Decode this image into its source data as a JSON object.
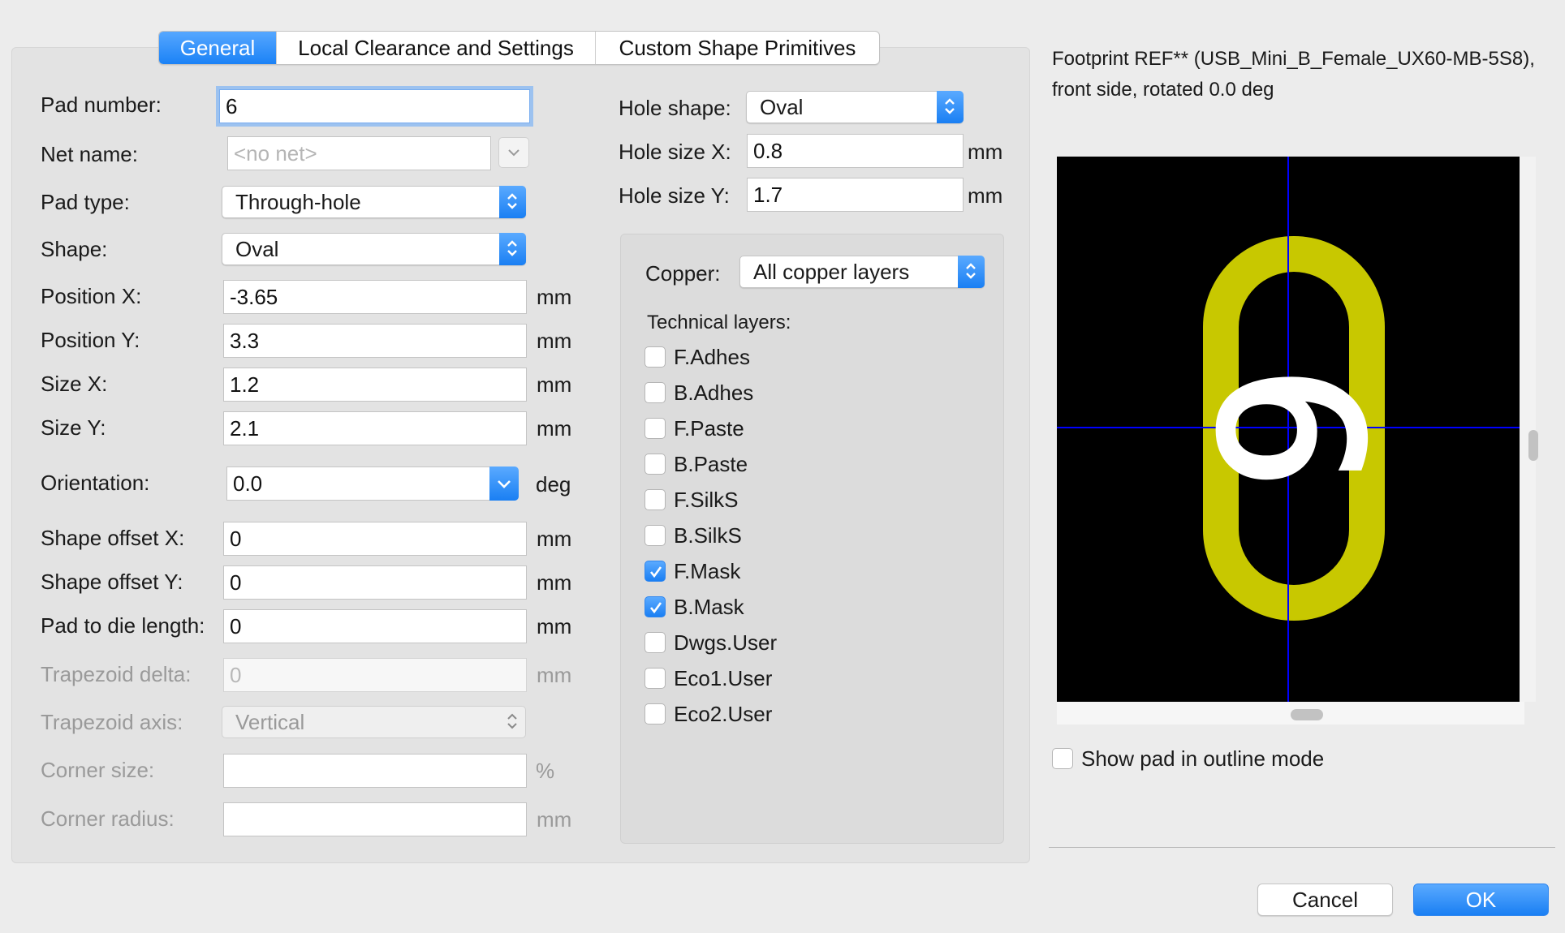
{
  "tabs": [
    "General",
    "Local Clearance and Settings",
    "Custom Shape Primitives"
  ],
  "form": {
    "pad_number": {
      "label": "Pad number:",
      "value": "6"
    },
    "net_name": {
      "label": "Net name:",
      "placeholder": "<no net>"
    },
    "pad_type": {
      "label": "Pad type:",
      "value": "Through-hole"
    },
    "shape": {
      "label": "Shape:",
      "value": "Oval"
    },
    "position_x": {
      "label": "Position X:",
      "value": "-3.65",
      "unit": "mm"
    },
    "position_y": {
      "label": "Position Y:",
      "value": "3.3",
      "unit": "mm"
    },
    "size_x": {
      "label": "Size X:",
      "value": "1.2",
      "unit": "mm"
    },
    "size_y": {
      "label": "Size Y:",
      "value": "2.1",
      "unit": "mm"
    },
    "orientation": {
      "label": "Orientation:",
      "value": "0.0",
      "unit": "deg"
    },
    "shape_offset_x": {
      "label": "Shape offset X:",
      "value": "0",
      "unit": "mm"
    },
    "shape_offset_y": {
      "label": "Shape offset Y:",
      "value": "0",
      "unit": "mm"
    },
    "pad_to_die": {
      "label": "Pad to die length:",
      "value": "0",
      "unit": "mm"
    },
    "trapezoid_delta": {
      "label": "Trapezoid delta:",
      "value": "0",
      "unit": "mm"
    },
    "trapezoid_axis": {
      "label": "Trapezoid axis:",
      "value": "Vertical"
    },
    "corner_size": {
      "label": "Corner size:",
      "value": "",
      "unit": "%"
    },
    "corner_radius": {
      "label": "Corner radius:",
      "value": "",
      "unit": "mm"
    }
  },
  "hole": {
    "shape": {
      "label": "Hole shape:",
      "value": "Oval"
    },
    "size_x": {
      "label": "Hole size X:",
      "value": "0.8",
      "unit": "mm"
    },
    "size_y": {
      "label": "Hole size Y:",
      "value": "1.7",
      "unit": "mm"
    }
  },
  "layers": {
    "copper_label": "Copper:",
    "copper_value": "All copper layers",
    "technical_label": "Technical layers:",
    "items": [
      {
        "name": "F.Adhes",
        "checked": false
      },
      {
        "name": "B.Adhes",
        "checked": false
      },
      {
        "name": "F.Paste",
        "checked": false
      },
      {
        "name": "B.Paste",
        "checked": false
      },
      {
        "name": "F.SilkS",
        "checked": false
      },
      {
        "name": "B.SilkS",
        "checked": false
      },
      {
        "name": "F.Mask",
        "checked": true
      },
      {
        "name": "B.Mask",
        "checked": true
      },
      {
        "name": "Dwgs.User",
        "checked": false
      },
      {
        "name": "Eco1.User",
        "checked": false
      },
      {
        "name": "Eco2.User",
        "checked": false
      }
    ]
  },
  "preview": {
    "info_line1": "Footprint REF** (USB_Mini_B_Female_UX60-MB-5S8),",
    "info_line2": "front side, rotated 0.0 deg",
    "pad_label": "6",
    "pad_color": "#c8c800",
    "crosshair_color": "#0000ff",
    "outline_mode_label": "Show pad in outline mode"
  },
  "buttons": {
    "cancel": "Cancel",
    "ok": "OK"
  }
}
